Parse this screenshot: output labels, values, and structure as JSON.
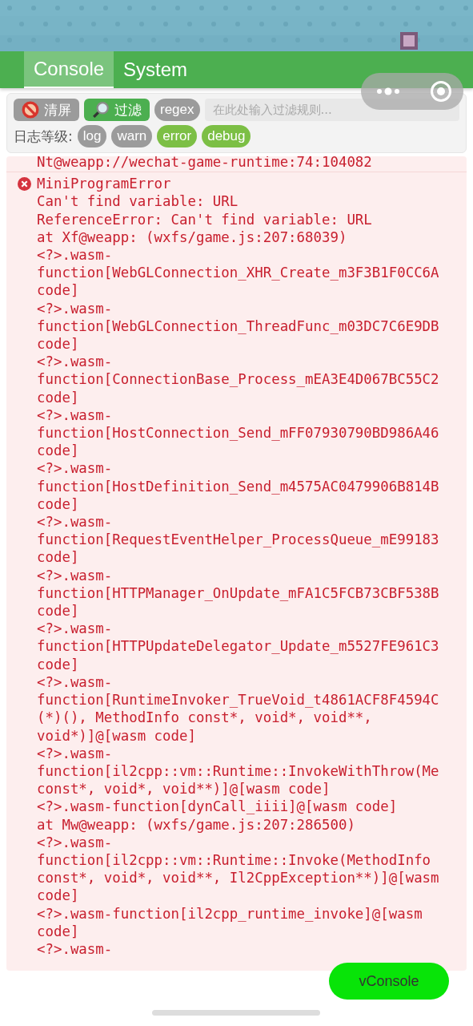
{
  "tabs": [
    {
      "label": "Console",
      "selected": true
    },
    {
      "label": "System",
      "selected": false
    }
  ],
  "toolbar": {
    "clear_button": "清屏",
    "filter_button": "过滤",
    "regex_button": "regex",
    "filter_field": {
      "placeholder": "在此处输入过滤规则..."
    }
  },
  "log_levels": {
    "label": "日志等级:",
    "levels": [
      {
        "label": "log",
        "selected": false
      },
      {
        "label": "warn",
        "selected": false
      },
      {
        "label": "error",
        "selected": true
      },
      {
        "label": "debug",
        "selected": true
      }
    ]
  },
  "logs": [
    {
      "kind": "continuation",
      "lines": [
        "Nt@weapp://wechat-game-runtime:74:104082"
      ]
    },
    {
      "kind": "error",
      "title": "MiniProgramError",
      "lines": [
        "Can't find variable: URL",
        "ReferenceError: Can't find variable: URL",
        "at Xf@weapp: (wxfs/game.js:207:68039)",
        "<?>.wasm-",
        "function[WebGLConnection_XHR_Create_m3F3B1F0CC6A",
        "code]",
        "<?>.wasm-",
        "function[WebGLConnection_ThreadFunc_m03DC7C6E9DB",
        "code]",
        "<?>.wasm-",
        "function[ConnectionBase_Process_mEA3E4D067BC55C2",
        "code]",
        "<?>.wasm-",
        "function[HostConnection_Send_mFF07930790BD986A46",
        "code]",
        "<?>.wasm-",
        "function[HostDefinition_Send_m4575AC0479906B814B",
        "code]",
        "<?>.wasm-",
        "function[RequestEventHelper_ProcessQueue_mE99183",
        "code]",
        "<?>.wasm-",
        "function[HTTPManager_OnUpdate_mFA1C5FCB73CBF538B",
        "code]",
        "<?>.wasm-",
        "function[HTTPUpdateDelegator_Update_m5527FE961C3",
        "code]",
        "<?>.wasm-",
        "function[RuntimeInvoker_TrueVoid_t4861ACF8F4594C",
        "(*)(), MethodInfo const*, void*, void**,",
        "void*)]@[wasm code]",
        "<?>.wasm-",
        "function[il2cpp::vm::Runtime::InvokeWithThrow(Me",
        "const*, void*, void**)]@[wasm code]",
        "<?>.wasm-function[dynCall_iiii]@[wasm code]",
        "at Mw@weapp: (wxfs/game.js:207:286500)",
        "<?>.wasm-",
        "function[il2cpp::vm::Runtime::Invoke(MethodInfo",
        "const*, void*, void**, Il2CppException**)]@[wasm",
        "code]",
        "<?>.wasm-function[il2cpp_runtime_invoke]@[wasm",
        "code]",
        "<?>.wasm-"
      ]
    }
  ],
  "vconsole_button": "vConsole"
}
